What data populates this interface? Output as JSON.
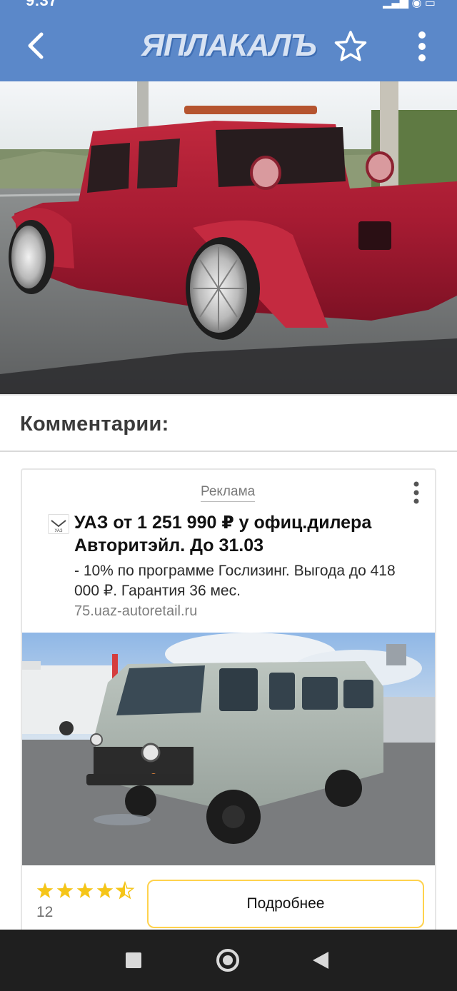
{
  "app": {
    "logo_text": "ЯПЛАКАЛЪ",
    "status_time": "9:37"
  },
  "comments": {
    "title": "Комментарии:"
  },
  "ad": {
    "label": "Реклама",
    "title": "УАЗ от 1 251 990 ₽ у офиц.дилера Авторитэйл. До 31.03",
    "description": "- 10% по программе Гослизинг. Выгода до 418 000 ₽. Гарантия 36 мес.",
    "url": "75.uaz-autoretail.ru",
    "logo_text": "УАЗ",
    "rating_value": 4.5,
    "rating_count": "12",
    "button_label": "Подробнее"
  },
  "colors": {
    "appbar": "#5b88c9",
    "star_fill": "#f5c518",
    "button_border": "#ffd24d",
    "navbar": "#1f1f1f"
  },
  "icons": {
    "back": "chevron-left-icon",
    "favorite": "star-outline-icon",
    "menu": "more-vertical-icon",
    "nav_recents": "square-icon",
    "nav_home": "circle-icon",
    "nav_back": "triangle-back-icon"
  }
}
